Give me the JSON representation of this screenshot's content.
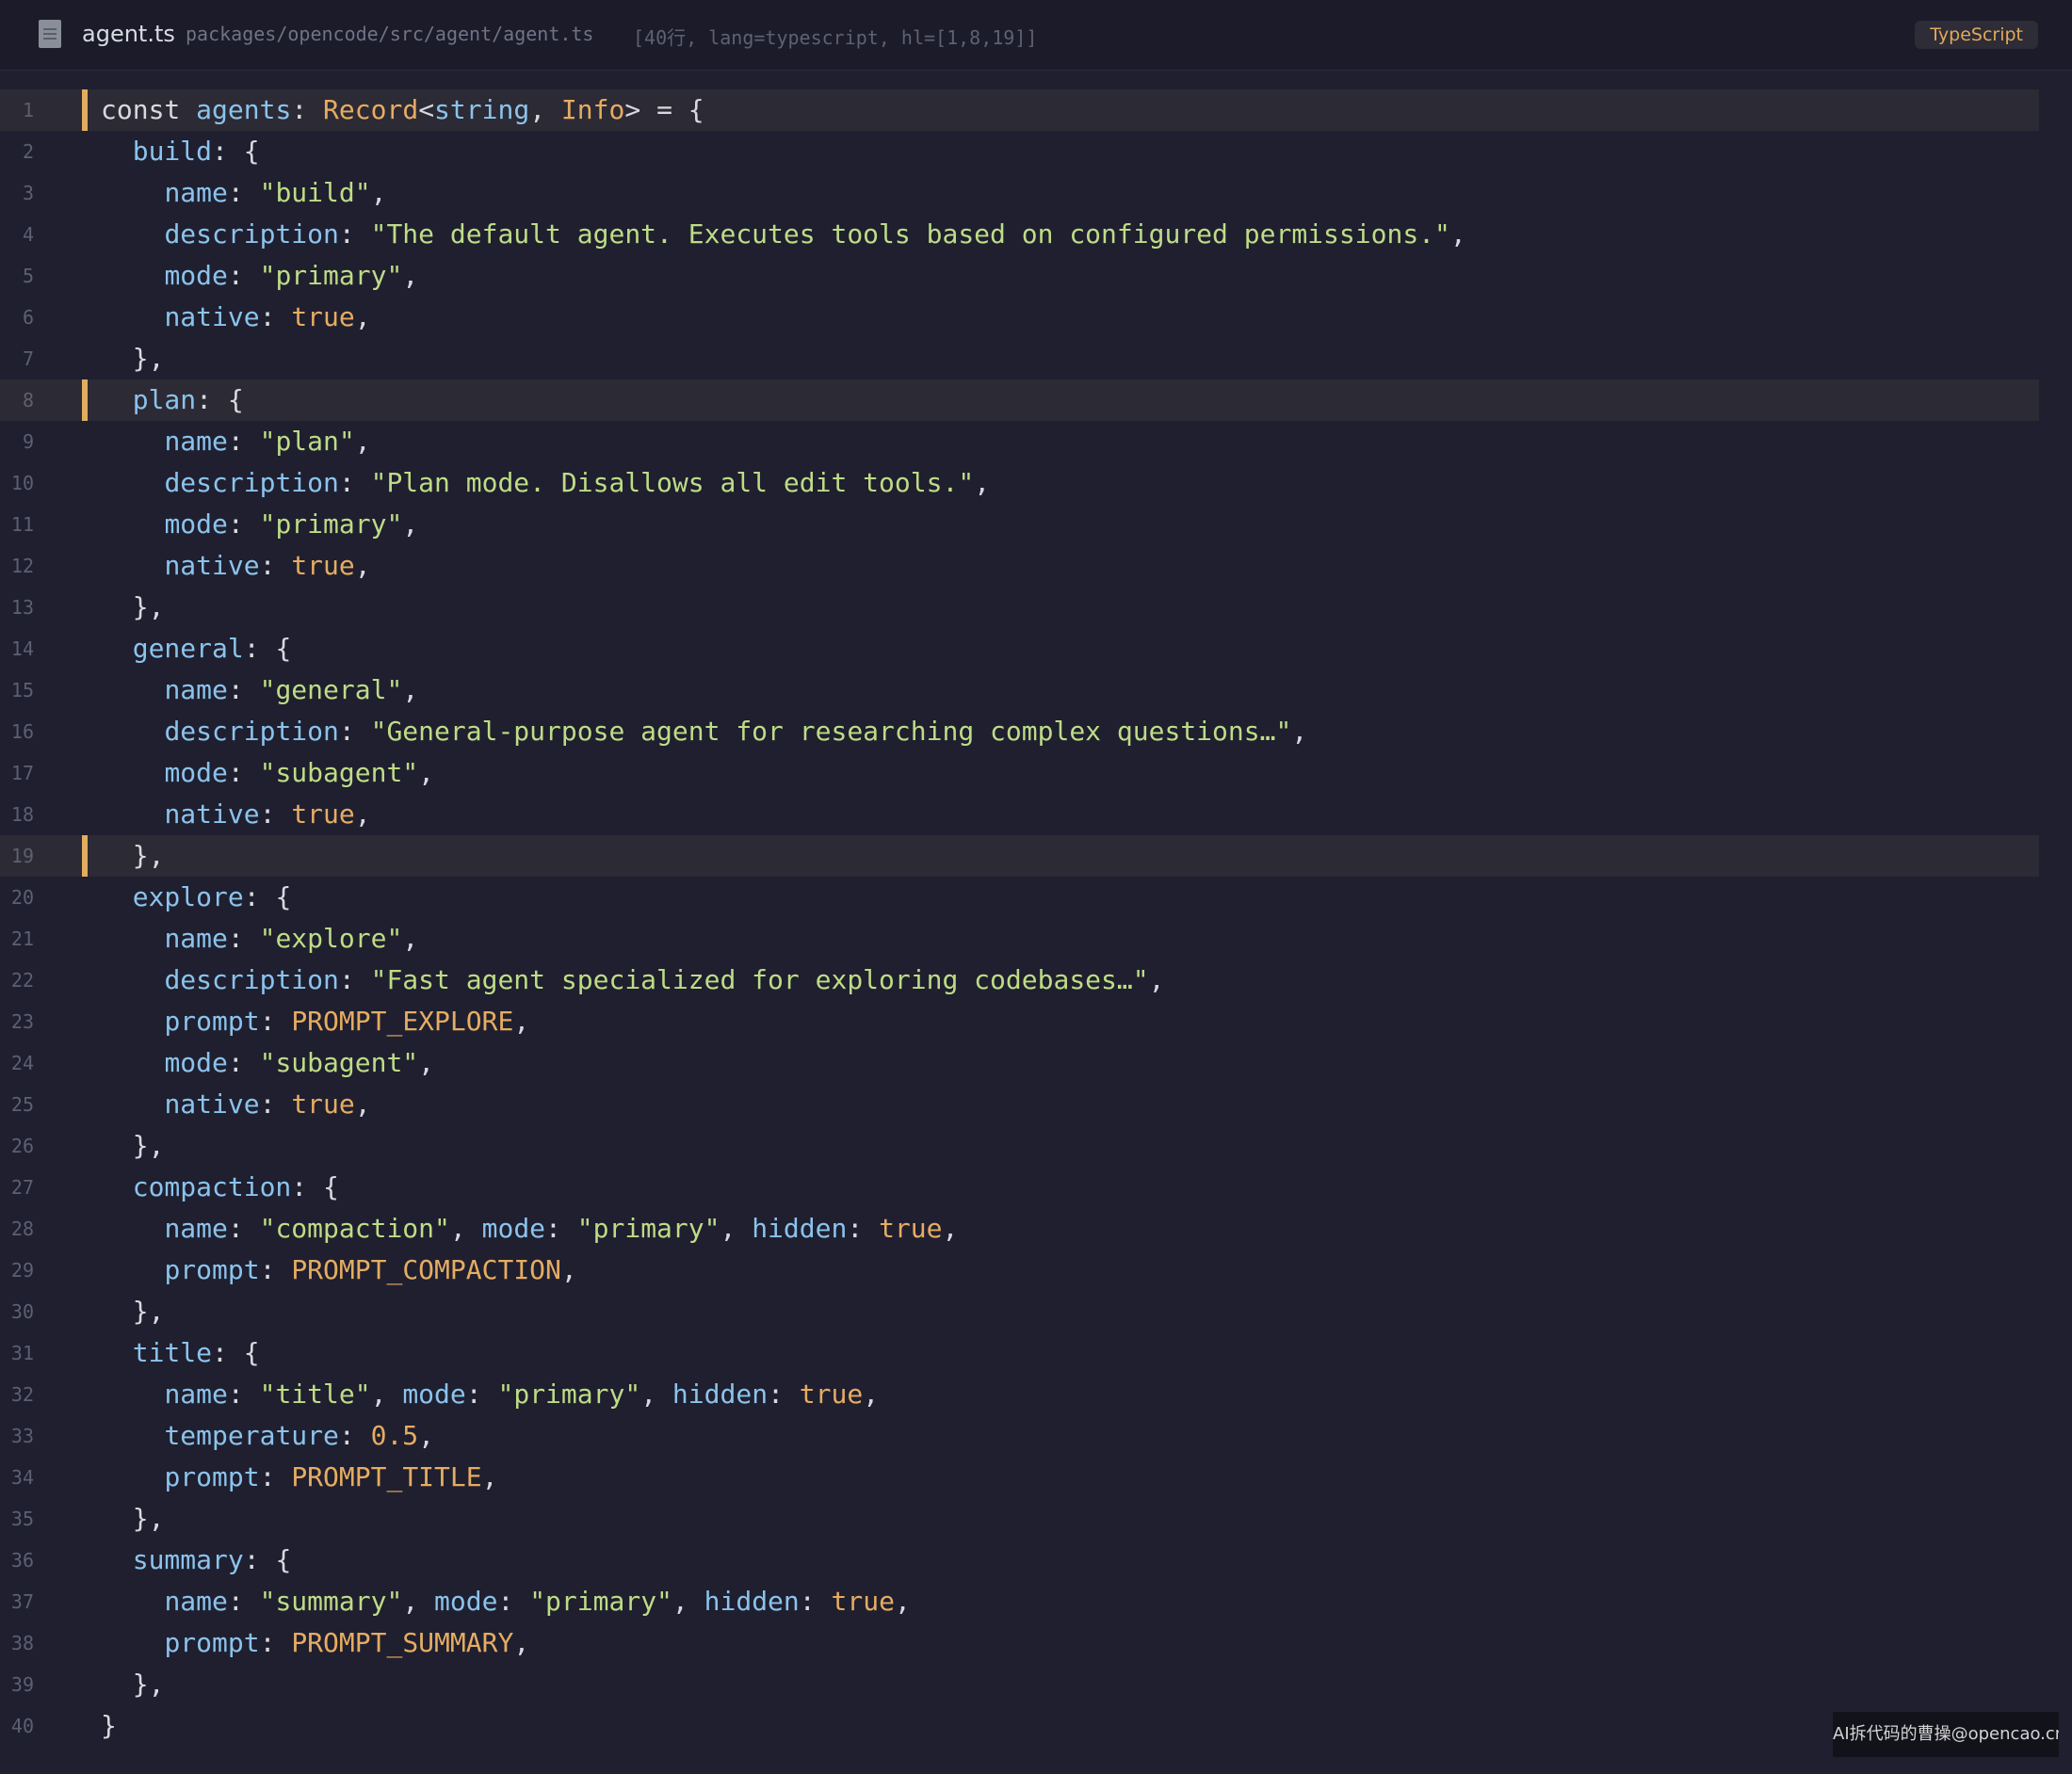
{
  "header": {
    "file_icon": "document-icon",
    "filename": "agent.ts",
    "path": "packages/opencode/src/agent/agent.ts",
    "meta": "[40行, lang=typescript, hl=[1,8,19]]",
    "language_badge": "TypeScript"
  },
  "colors": {
    "background": "#1f1f2f",
    "highlight_bar": "#e2ad5e",
    "key": "#8bc3ec",
    "string": "#bedc86",
    "literal": "#e6ac62"
  },
  "highlighted_lines": [
    1,
    8,
    19
  ],
  "code_lines": [
    [
      [
        "kw",
        "const "
      ],
      [
        "k",
        "agents"
      ],
      [
        "p",
        ": "
      ],
      [
        "b",
        "Record"
      ],
      [
        "p",
        "<"
      ],
      [
        "k",
        "string"
      ],
      [
        "p",
        ", "
      ],
      [
        "b",
        "Info"
      ],
      [
        "p",
        "> = {"
      ]
    ],
    [
      [
        "p",
        "  "
      ],
      [
        "k",
        "build"
      ],
      [
        "p",
        ": {"
      ]
    ],
    [
      [
        "p",
        "    "
      ],
      [
        "k",
        "name"
      ],
      [
        "p",
        ": "
      ],
      [
        "s",
        "\"build\""
      ],
      [
        "p",
        ","
      ]
    ],
    [
      [
        "p",
        "    "
      ],
      [
        "k",
        "description"
      ],
      [
        "p",
        ": "
      ],
      [
        "s",
        "\"The default agent. Executes tools based on configured permissions.\""
      ],
      [
        "p",
        ","
      ]
    ],
    [
      [
        "p",
        "    "
      ],
      [
        "k",
        "mode"
      ],
      [
        "p",
        ": "
      ],
      [
        "s",
        "\"primary\""
      ],
      [
        "p",
        ","
      ]
    ],
    [
      [
        "p",
        "    "
      ],
      [
        "k",
        "native"
      ],
      [
        "p",
        ": "
      ],
      [
        "b",
        "true"
      ],
      [
        "p",
        ","
      ]
    ],
    [
      [
        "p",
        "  },"
      ]
    ],
    [
      [
        "p",
        "  "
      ],
      [
        "k",
        "plan"
      ],
      [
        "p",
        ": {"
      ]
    ],
    [
      [
        "p",
        "    "
      ],
      [
        "k",
        "name"
      ],
      [
        "p",
        ": "
      ],
      [
        "s",
        "\"plan\""
      ],
      [
        "p",
        ","
      ]
    ],
    [
      [
        "p",
        "    "
      ],
      [
        "k",
        "description"
      ],
      [
        "p",
        ": "
      ],
      [
        "s",
        "\"Plan mode. Disallows all edit tools.\""
      ],
      [
        "p",
        ","
      ]
    ],
    [
      [
        "p",
        "    "
      ],
      [
        "k",
        "mode"
      ],
      [
        "p",
        ": "
      ],
      [
        "s",
        "\"primary\""
      ],
      [
        "p",
        ","
      ]
    ],
    [
      [
        "p",
        "    "
      ],
      [
        "k",
        "native"
      ],
      [
        "p",
        ": "
      ],
      [
        "b",
        "true"
      ],
      [
        "p",
        ","
      ]
    ],
    [
      [
        "p",
        "  },"
      ]
    ],
    [
      [
        "p",
        "  "
      ],
      [
        "k",
        "general"
      ],
      [
        "p",
        ": {"
      ]
    ],
    [
      [
        "p",
        "    "
      ],
      [
        "k",
        "name"
      ],
      [
        "p",
        ": "
      ],
      [
        "s",
        "\"general\""
      ],
      [
        "p",
        ","
      ]
    ],
    [
      [
        "p",
        "    "
      ],
      [
        "k",
        "description"
      ],
      [
        "p",
        ": "
      ],
      [
        "s",
        "\"General-purpose agent for researching complex questions…\""
      ],
      [
        "p",
        ","
      ]
    ],
    [
      [
        "p",
        "    "
      ],
      [
        "k",
        "mode"
      ],
      [
        "p",
        ": "
      ],
      [
        "s",
        "\"subagent\""
      ],
      [
        "p",
        ","
      ]
    ],
    [
      [
        "p",
        "    "
      ],
      [
        "k",
        "native"
      ],
      [
        "p",
        ": "
      ],
      [
        "b",
        "true"
      ],
      [
        "p",
        ","
      ]
    ],
    [
      [
        "p",
        "  },"
      ]
    ],
    [
      [
        "p",
        "  "
      ],
      [
        "k",
        "explore"
      ],
      [
        "p",
        ": {"
      ]
    ],
    [
      [
        "p",
        "    "
      ],
      [
        "k",
        "name"
      ],
      [
        "p",
        ": "
      ],
      [
        "s",
        "\"explore\""
      ],
      [
        "p",
        ","
      ]
    ],
    [
      [
        "p",
        "    "
      ],
      [
        "k",
        "description"
      ],
      [
        "p",
        ": "
      ],
      [
        "s",
        "\"Fast agent specialized for exploring codebases…\""
      ],
      [
        "p",
        ","
      ]
    ],
    [
      [
        "p",
        "    "
      ],
      [
        "k",
        "prompt"
      ],
      [
        "p",
        ": "
      ],
      [
        "b",
        "PROMPT_EXPLORE"
      ],
      [
        "p",
        ","
      ]
    ],
    [
      [
        "p",
        "    "
      ],
      [
        "k",
        "mode"
      ],
      [
        "p",
        ": "
      ],
      [
        "s",
        "\"subagent\""
      ],
      [
        "p",
        ","
      ]
    ],
    [
      [
        "p",
        "    "
      ],
      [
        "k",
        "native"
      ],
      [
        "p",
        ": "
      ],
      [
        "b",
        "true"
      ],
      [
        "p",
        ","
      ]
    ],
    [
      [
        "p",
        "  },"
      ]
    ],
    [
      [
        "p",
        "  "
      ],
      [
        "k",
        "compaction"
      ],
      [
        "p",
        ": {"
      ]
    ],
    [
      [
        "p",
        "    "
      ],
      [
        "k",
        "name"
      ],
      [
        "p",
        ": "
      ],
      [
        "s",
        "\"compaction\""
      ],
      [
        "p",
        ", "
      ],
      [
        "k",
        "mode"
      ],
      [
        "p",
        ": "
      ],
      [
        "s",
        "\"primary\""
      ],
      [
        "p",
        ", "
      ],
      [
        "k",
        "hidden"
      ],
      [
        "p",
        ": "
      ],
      [
        "b",
        "true"
      ],
      [
        "p",
        ","
      ]
    ],
    [
      [
        "p",
        "    "
      ],
      [
        "k",
        "prompt"
      ],
      [
        "p",
        ": "
      ],
      [
        "b",
        "PROMPT_COMPACTION"
      ],
      [
        "p",
        ","
      ]
    ],
    [
      [
        "p",
        "  },"
      ]
    ],
    [
      [
        "p",
        "  "
      ],
      [
        "k",
        "title"
      ],
      [
        "p",
        ": {"
      ]
    ],
    [
      [
        "p",
        "    "
      ],
      [
        "k",
        "name"
      ],
      [
        "p",
        ": "
      ],
      [
        "s",
        "\"title\""
      ],
      [
        "p",
        ", "
      ],
      [
        "k",
        "mode"
      ],
      [
        "p",
        ": "
      ],
      [
        "s",
        "\"primary\""
      ],
      [
        "p",
        ", "
      ],
      [
        "k",
        "hidden"
      ],
      [
        "p",
        ": "
      ],
      [
        "b",
        "true"
      ],
      [
        "p",
        ","
      ]
    ],
    [
      [
        "p",
        "    "
      ],
      [
        "k",
        "temperature"
      ],
      [
        "p",
        ": "
      ],
      [
        "b",
        "0.5"
      ],
      [
        "p",
        ","
      ]
    ],
    [
      [
        "p",
        "    "
      ],
      [
        "k",
        "prompt"
      ],
      [
        "p",
        ": "
      ],
      [
        "b",
        "PROMPT_TITLE"
      ],
      [
        "p",
        ","
      ]
    ],
    [
      [
        "p",
        "  },"
      ]
    ],
    [
      [
        "p",
        "  "
      ],
      [
        "k",
        "summary"
      ],
      [
        "p",
        ": {"
      ]
    ],
    [
      [
        "p",
        "    "
      ],
      [
        "k",
        "name"
      ],
      [
        "p",
        ": "
      ],
      [
        "s",
        "\"summary\""
      ],
      [
        "p",
        ", "
      ],
      [
        "k",
        "mode"
      ],
      [
        "p",
        ": "
      ],
      [
        "s",
        "\"primary\""
      ],
      [
        "p",
        ", "
      ],
      [
        "k",
        "hidden"
      ],
      [
        "p",
        ": "
      ],
      [
        "b",
        "true"
      ],
      [
        "p",
        ","
      ]
    ],
    [
      [
        "p",
        "    "
      ],
      [
        "k",
        "prompt"
      ],
      [
        "p",
        ": "
      ],
      [
        "b",
        "PROMPT_SUMMARY"
      ],
      [
        "p",
        ","
      ]
    ],
    [
      [
        "p",
        "  },"
      ]
    ],
    [
      [
        "p",
        "}"
      ]
    ]
  ],
  "watermark": "AI拆代码的曹操@opencao.cn"
}
